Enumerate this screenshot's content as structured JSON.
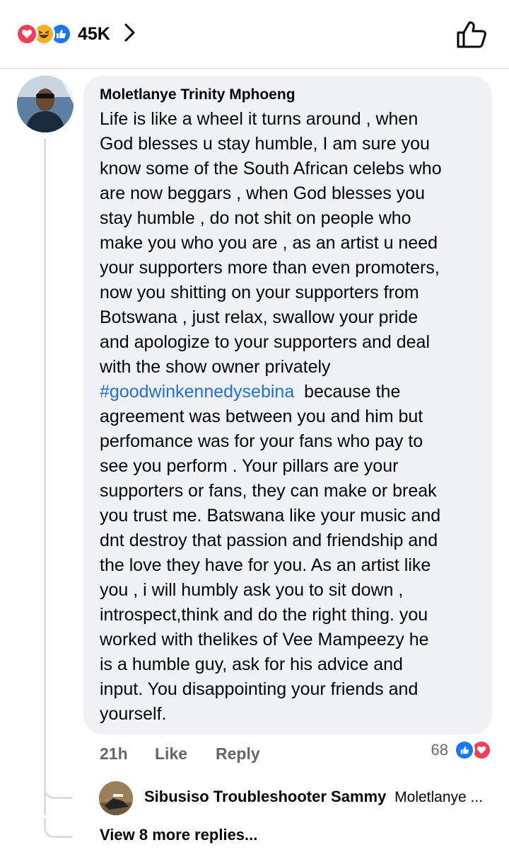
{
  "reactions": {
    "count": "45K",
    "icons": [
      "love-icon",
      "haha-icon",
      "like-icon"
    ]
  },
  "comment": {
    "author": "Moletlanye Trinity Mphoeng",
    "lines": [
      "Life is like a wheel  it turns around , when",
      "God blesses u stay humble, I am sure you",
      "know some of the South African celebs who",
      "are now beggars , when God blesses you",
      "stay humble , do not shit on people who",
      "make you who you are , as an artist u need",
      "your supporters more than even promoters,",
      "now you shitting on your supporters from",
      "Botswana ,  just relax, swallow your pride",
      "and apologize to your supporters and deal",
      "with the show owner privately"
    ],
    "hashtag": "#goodwinkennedysebina",
    "hashtag_rest": "  because the",
    "lines_after": [
      "agreement was between you and him  but",
      "perfomance was for your fans who pay to",
      "see you perform . Your pillars are your",
      "supporters or fans, they can make or break",
      "you trust me. Batswana like your music and",
      "dnt destroy that passion and friendship and",
      "the love they have for you. As an artist like",
      "you , i will humbly ask you to sit down ,",
      "introspect,think and do the right thing. you",
      "worked with thelikes of  Vee Mampeezy he",
      "is a humble guy, ask for his advice and",
      "input. You disappointing your friends and",
      "yourself."
    ],
    "time": "21h",
    "like_label": "Like",
    "reply_label": "Reply",
    "reaction_count": "68"
  },
  "reply_preview": {
    "name": "Sibusiso Troubleshooter Sammy",
    "snippet": "Moletlanye ..."
  },
  "view_more": "View 8 more replies..."
}
